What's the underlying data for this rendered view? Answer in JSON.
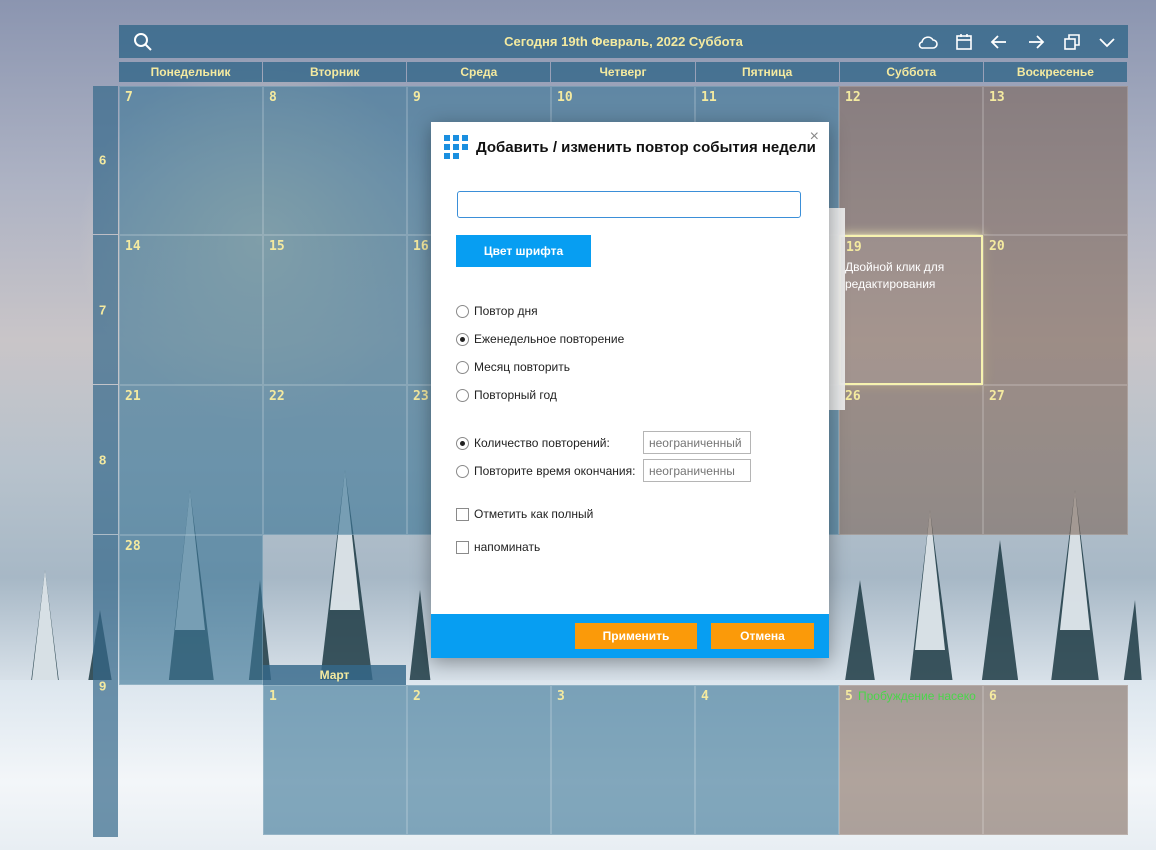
{
  "header": {
    "title": "Сегодня 19th Февраль, 2022 Суббота",
    "icons": [
      "search-icon",
      "cloud-icon",
      "calendar-icon",
      "arrow-left-icon",
      "arrow-right-icon",
      "restore-window-icon",
      "chevron-down-icon"
    ]
  },
  "weekdays": [
    "Понедельник",
    "Вторник",
    "Среда",
    "Четверг",
    "Пятница",
    "Суббота",
    "Воскресенье"
  ],
  "weeks": [
    "6",
    "7",
    "8",
    "9"
  ],
  "days": {
    "w6": [
      "7",
      "8",
      "9",
      "10",
      "11",
      "12",
      "13"
    ],
    "w7": [
      "14",
      "15",
      "16",
      "19",
      "20"
    ],
    "w8": [
      "21",
      "22",
      "23",
      "26",
      "27"
    ],
    "w9": [
      "28",
      "1",
      "2",
      "3",
      "4",
      "5",
      "6"
    ]
  },
  "today_hint": "Двойной клик для редактирования",
  "event_mar5": "Пробуждение насеко",
  "month_label": "Март",
  "dialog": {
    "title": "Добавить / изменить повтор события недели",
    "close": "×",
    "text_value": "",
    "font_color_button": "Цвет шрифта",
    "repeat_day": "Повтор дня",
    "repeat_week": "Еженедельное повторение",
    "repeat_month": "Месяц повторить",
    "repeat_year": "Повторный год",
    "repeat_count_label": "Количество повторений:",
    "repeat_count_placeholder": "неограниченный",
    "repeat_end_label": "Повторите время окончания:",
    "repeat_end_placeholder": "неограниченны",
    "mark_complete": "Отметить как полный",
    "remind": "напоминать",
    "apply": "Применить",
    "cancel": "Отмена"
  },
  "colors": {
    "accent": "#079ef2",
    "button_orange": "#fb9a09",
    "header_text": "#f4eaa0"
  }
}
